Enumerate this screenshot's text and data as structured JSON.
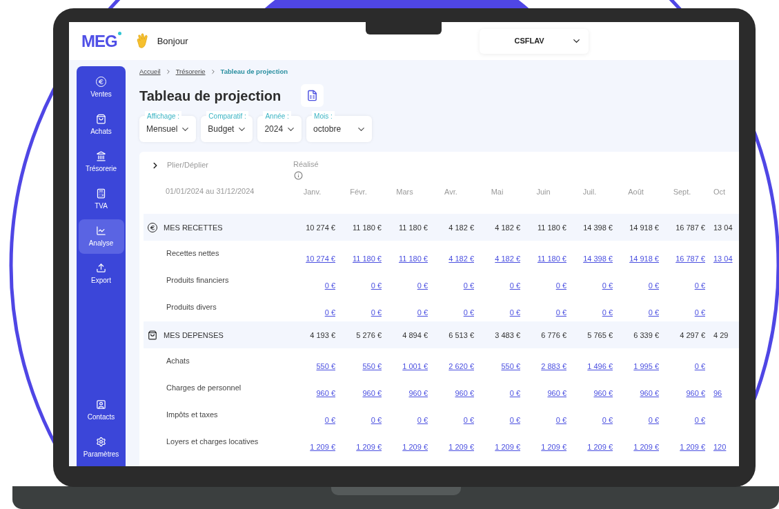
{
  "header": {
    "logo": "MEG",
    "greeting": "Bonjour",
    "company": "CSFLAV"
  },
  "sidebar": {
    "items": [
      {
        "kind": "euro",
        "label": "Ventes",
        "selected": false
      },
      {
        "kind": "bag",
        "label": "Achats",
        "selected": false
      },
      {
        "kind": "bank",
        "label": "Trésorerie",
        "selected": false
      },
      {
        "kind": "calculator",
        "label": "TVA",
        "selected": false
      },
      {
        "kind": "chart",
        "label": "Analyse",
        "selected": true
      },
      {
        "kind": "upload",
        "label": "Export",
        "selected": false
      }
    ],
    "bottom_items": [
      {
        "kind": "contact",
        "label": "Contacts",
        "selected": false
      },
      {
        "kind": "gear",
        "label": "Paramètres",
        "selected": false
      }
    ]
  },
  "breadcrumb": [
    {
      "label": "Accueil",
      "current": false
    },
    {
      "label": "Trésorerie",
      "current": false
    },
    {
      "label": "Tableau de projection",
      "current": true
    }
  ],
  "title": "Tableau de projection",
  "filters": [
    {
      "label": "Affichage :",
      "value": "Mensuel"
    },
    {
      "label": "Comparatif :",
      "value": "Budget"
    },
    {
      "label": "Année :",
      "value": "2024"
    },
    {
      "label": "Mois :",
      "value": "octobre"
    }
  ],
  "table": {
    "toggle_label": "Plier/Déplier",
    "realised_label": "Réalisé",
    "period": "01/01/2024 au 31/12/2024",
    "months": [
      "Janv.",
      "Févr.",
      "Mars",
      "Avr.",
      "Mai",
      "Juin",
      "Juil.",
      "Août",
      "Sept.",
      "Oct"
    ],
    "sections": [
      {
        "kind": "income",
        "title": "MES RECETTES",
        "totals": [
          "10 274 €",
          "11 180 €",
          "11 180 €",
          "4 182 €",
          "4 182 €",
          "11 180 €",
          "14 398 €",
          "14 918 €",
          "16 787 €",
          "13 04"
        ],
        "rows": [
          {
            "label": "Recettes nettes",
            "values": [
              "10 274 €",
              "11 180 €",
              "11 180 €",
              "4 182 €",
              "4 182 €",
              "11 180 €",
              "14 398 €",
              "14 918 €",
              "16 787 €",
              "13 04"
            ]
          },
          {
            "label": "Produits financiers",
            "values": [
              "0 €",
              "0 €",
              "0 €",
              "0 €",
              "0 €",
              "0 €",
              "0 €",
              "0 €",
              "0 €"
            ]
          },
          {
            "label": "Produits divers",
            "values": [
              "0 €",
              "0 €",
              "0 €",
              "0 €",
              "0 €",
              "0 €",
              "0 €",
              "0 €",
              "0 €"
            ]
          }
        ]
      },
      {
        "kind": "expense",
        "title": "MES DEPENSES",
        "totals": [
          "4 193 €",
          "5 276 €",
          "4 894 €",
          "6 513 €",
          "3 483 €",
          "6 776 €",
          "5 765 €",
          "6 339 €",
          "4 297 €",
          "4 29"
        ],
        "rows": [
          {
            "label": "Achats",
            "values": [
              "550 €",
              "550 €",
              "1 001 €",
              "2 620 €",
              "550 €",
              "2 883 €",
              "1 496 €",
              "1 995 €",
              "0 €"
            ]
          },
          {
            "label": "Charges de personnel",
            "values": [
              "960 €",
              "960 €",
              "960 €",
              "960 €",
              "0 €",
              "960 €",
              "960 €",
              "960 €",
              "960 €",
              "96"
            ]
          },
          {
            "label": "Impôts et taxes",
            "values": [
              "0 €",
              "0 €",
              "0 €",
              "0 €",
              "0 €",
              "0 €",
              "0 €",
              "0 €",
              "0 €"
            ]
          },
          {
            "label": "Loyers et charges locatives",
            "values": [
              "1 209 €",
              "1 209 €",
              "1 209 €",
              "1 209 €",
              "1 209 €",
              "1 209 €",
              "1 209 €",
              "1 209 €",
              "1 209 €",
              "120"
            ]
          }
        ]
      }
    ]
  }
}
